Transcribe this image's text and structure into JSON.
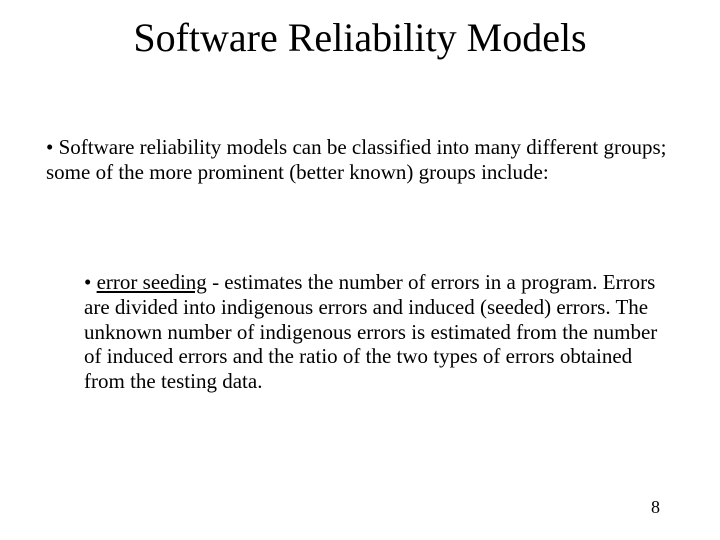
{
  "title": "Software Reliability Models",
  "para1": "• Software reliability models can be classified into many different groups; some of the more prominent (better known) groups include:",
  "bullet2_prefix": "• ",
  "bullet2_term": "error seeding",
  "bullet2_rest": " - estimates the number of errors in a program. Errors are divided into indigenous errors and induced (seeded) errors. The unknown number of indigenous errors is estimated from the number of induced errors and the ratio of the two types of errors obtained from the testing data.",
  "page_number": "8"
}
